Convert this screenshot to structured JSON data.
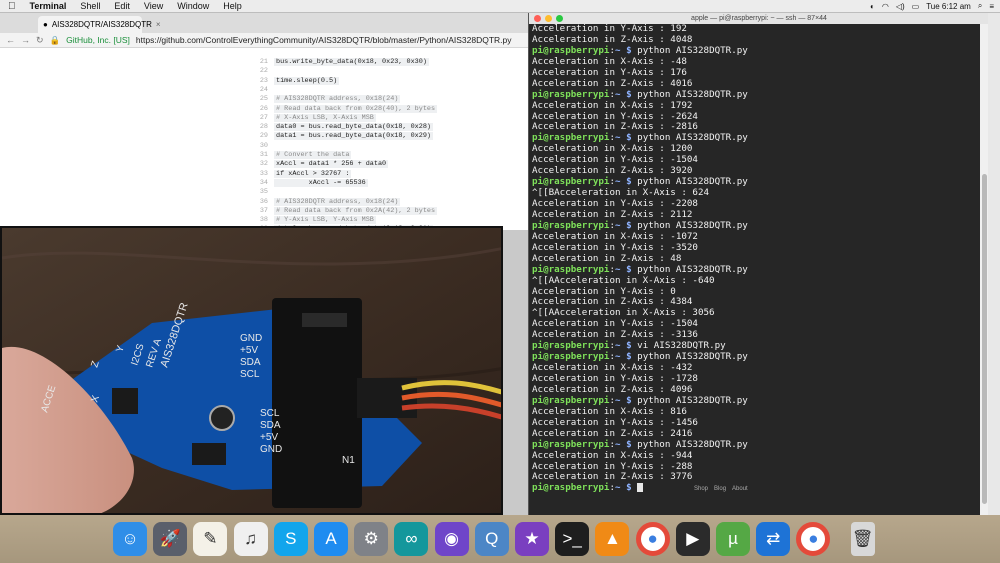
{
  "menubar": {
    "app_name": "Terminal",
    "items": [
      "Shell",
      "Edit",
      "View",
      "Window",
      "Help"
    ],
    "clock": "Tue 6:12 am"
  },
  "browser": {
    "tab_title": "AIS328DQTR/AIS328DQTR",
    "secure_label": "GitHub, Inc. [US]",
    "url": "https://github.com/ControlEverythingCommunity/AIS328DQTR/blob/master/Python/AIS328DQTR.py",
    "code_lines": [
      {
        "n": "21",
        "t": "bus.write_byte_data(0x18, 0x23, 0x30)",
        "c": false
      },
      {
        "n": "22",
        "t": "",
        "c": false
      },
      {
        "n": "23",
        "t": "time.sleep(0.5)",
        "c": false
      },
      {
        "n": "24",
        "t": "",
        "c": false
      },
      {
        "n": "25",
        "t": "# AIS328DQTR address, 0x18(24)",
        "c": true
      },
      {
        "n": "26",
        "t": "# Read data back from 0x28(40), 2 bytes",
        "c": true
      },
      {
        "n": "27",
        "t": "# X-Axis LSB, X-Axis MSB",
        "c": true
      },
      {
        "n": "28",
        "t": "data0 = bus.read_byte_data(0x18, 0x28)",
        "c": false
      },
      {
        "n": "29",
        "t": "data1 = bus.read_byte_data(0x18, 0x29)",
        "c": false
      },
      {
        "n": "30",
        "t": "",
        "c": false
      },
      {
        "n": "31",
        "t": "# Convert the data",
        "c": true
      },
      {
        "n": "32",
        "t": "xAccl = data1 * 256 + data0",
        "c": false
      },
      {
        "n": "33",
        "t": "if xAccl > 32767 :",
        "c": false
      },
      {
        "n": "34",
        "t": "        xAccl -= 65536",
        "c": false
      },
      {
        "n": "35",
        "t": "",
        "c": false
      },
      {
        "n": "36",
        "t": "# AIS328DQTR address, 0x18(24)",
        "c": true
      },
      {
        "n": "37",
        "t": "# Read data back from 0x2A(42), 2 bytes",
        "c": true
      },
      {
        "n": "38",
        "t": "# Y-Axis LSB, Y-Axis MSB",
        "c": true
      },
      {
        "n": "39",
        "t": "data0 = bus.read_byte_data(0x18, 0x2A)",
        "c": false
      }
    ]
  },
  "terminal": {
    "title": "apple — pi@raspberrypi: ~ — ssh — 87×44",
    "prompt_user": "pi@raspberrypi",
    "prompt_path": "~ $",
    "lines": [
      {
        "p": false,
        "t": "Acceleration in Y-Axis : 192"
      },
      {
        "p": false,
        "t": "Acceleration in Z-Axis : 4048"
      },
      {
        "p": true,
        "t": "python AIS328DQTR.py"
      },
      {
        "p": false,
        "t": "Acceleration in X-Axis : -48"
      },
      {
        "p": false,
        "t": "Acceleration in Y-Axis : 176"
      },
      {
        "p": false,
        "t": "Acceleration in Z-Axis : 4016"
      },
      {
        "p": true,
        "t": "python AIS328DQTR.py"
      },
      {
        "p": false,
        "t": "Acceleration in X-Axis : 1792"
      },
      {
        "p": false,
        "t": "Acceleration in Y-Axis : -2624"
      },
      {
        "p": false,
        "t": "Acceleration in Z-Axis : -2816"
      },
      {
        "p": true,
        "t": "python AIS328DQTR.py"
      },
      {
        "p": false,
        "t": "Acceleration in X-Axis : 1200"
      },
      {
        "p": false,
        "t": "Acceleration in Y-Axis : -1504"
      },
      {
        "p": false,
        "t": "Acceleration in Z-Axis : 3920"
      },
      {
        "p": true,
        "t": "python AIS328DQTR.py"
      },
      {
        "p": false,
        "t": "^[[BAcceleration in X-Axis : 624"
      },
      {
        "p": false,
        "t": "Acceleration in Y-Axis : -2208"
      },
      {
        "p": false,
        "t": "Acceleration in Z-Axis : 2112"
      },
      {
        "p": true,
        "t": "python AIS328DQTR.py"
      },
      {
        "p": false,
        "t": "Acceleration in X-Axis : -1072"
      },
      {
        "p": false,
        "t": "Acceleration in Y-Axis : -3520"
      },
      {
        "p": false,
        "t": "Acceleration in Z-Axis : 48"
      },
      {
        "p": true,
        "t": "python AIS328DQTR.py"
      },
      {
        "p": false,
        "t": "^[[AAcceleration in X-Axis : -640"
      },
      {
        "p": false,
        "t": "Acceleration in Y-Axis : 0"
      },
      {
        "p": false,
        "t": "Acceleration in Z-Axis : 4384"
      },
      {
        "p": false,
        "t": "^[[AAcceleration in X-Axis : 3056"
      },
      {
        "p": false,
        "t": "Acceleration in Y-Axis : -1504"
      },
      {
        "p": false,
        "t": "Acceleration in Z-Axis : -3136"
      },
      {
        "p": true,
        "t": "vi AIS328DQTR.py"
      },
      {
        "p": true,
        "t": "python AIS328DQTR.py"
      },
      {
        "p": false,
        "t": "Acceleration in X-Axis : -432"
      },
      {
        "p": false,
        "t": "Acceleration in Y-Axis : -1728"
      },
      {
        "p": false,
        "t": "Acceleration in Z-Axis : 4096"
      },
      {
        "p": true,
        "t": "python AIS328DQTR.py"
      },
      {
        "p": false,
        "t": "Acceleration in X-Axis : 816"
      },
      {
        "p": false,
        "t": "Acceleration in Y-Axis : -1456"
      },
      {
        "p": false,
        "t": "Acceleration in Z-Axis : 2416"
      },
      {
        "p": true,
        "t": "python AIS328DQTR.py"
      },
      {
        "p": false,
        "t": "Acceleration in X-Axis : -944"
      },
      {
        "p": false,
        "t": "Acceleration in Y-Axis : -288"
      },
      {
        "p": false,
        "t": "Acceleration in Z-Axis : 3776"
      },
      {
        "p": true,
        "t": ""
      }
    ],
    "footer_links": [
      "Shop",
      "Blog",
      "About"
    ]
  },
  "video": {
    "board_labels": {
      "part": "AIS328DQTR",
      "rev": "REV A",
      "bus": "I2CS",
      "pins_top": [
        "GND",
        "+5V",
        "SDA",
        "SCL"
      ],
      "pins_bottom": [
        "SCL",
        "SDA",
        "+5V",
        "GND"
      ],
      "connector": "N1",
      "left_edge": "ACCE",
      "axes": [
        "Z",
        "Y",
        "X"
      ]
    }
  },
  "dock": {
    "apps": [
      {
        "name": "finder-icon",
        "color": "#2f8ee8",
        "glyph": "☺"
      },
      {
        "name": "launchpad-icon",
        "color": "#5a5f6b",
        "glyph": "🚀"
      },
      {
        "name": "textedit-icon",
        "color": "#f4f1e8",
        "glyph": "✎"
      },
      {
        "name": "itunes-icon",
        "color": "#f0f0f0",
        "glyph": "♫"
      },
      {
        "name": "skype-icon",
        "color": "#12a5ec",
        "glyph": "S"
      },
      {
        "name": "app-store-icon",
        "color": "#1f8cf0",
        "glyph": "A"
      },
      {
        "name": "system-preferences-icon",
        "color": "#7f8288",
        "glyph": "⚙"
      },
      {
        "name": "arduino-icon",
        "color": "#14979c",
        "glyph": "∞"
      },
      {
        "name": "github-desktop-icon",
        "color": "#6f45c9",
        "glyph": "◉"
      },
      {
        "name": "quicktime-icon",
        "color": "#4c86c6",
        "glyph": "Q"
      },
      {
        "name": "imovie-icon",
        "color": "#7a3fc0",
        "glyph": "★"
      },
      {
        "name": "terminal-icon",
        "color": "#1e1e1e",
        "glyph": ">_"
      },
      {
        "name": "vlc-icon",
        "color": "#f08a16",
        "glyph": "▲"
      },
      {
        "name": "chrome-icon",
        "color": "#ffffff",
        "glyph": "●"
      },
      {
        "name": "video-player-icon",
        "color": "#2b2b2b",
        "glyph": "▶"
      },
      {
        "name": "utorrent-icon",
        "color": "#55a845",
        "glyph": "µ"
      },
      {
        "name": "teamviewer-icon",
        "color": "#1e73d6",
        "glyph": "⇄"
      },
      {
        "name": "chrome-icon-2",
        "color": "#ffffff",
        "glyph": "●"
      },
      {
        "name": "trash-icon",
        "color": "#d8d8d8",
        "glyph": "🗑"
      }
    ]
  }
}
